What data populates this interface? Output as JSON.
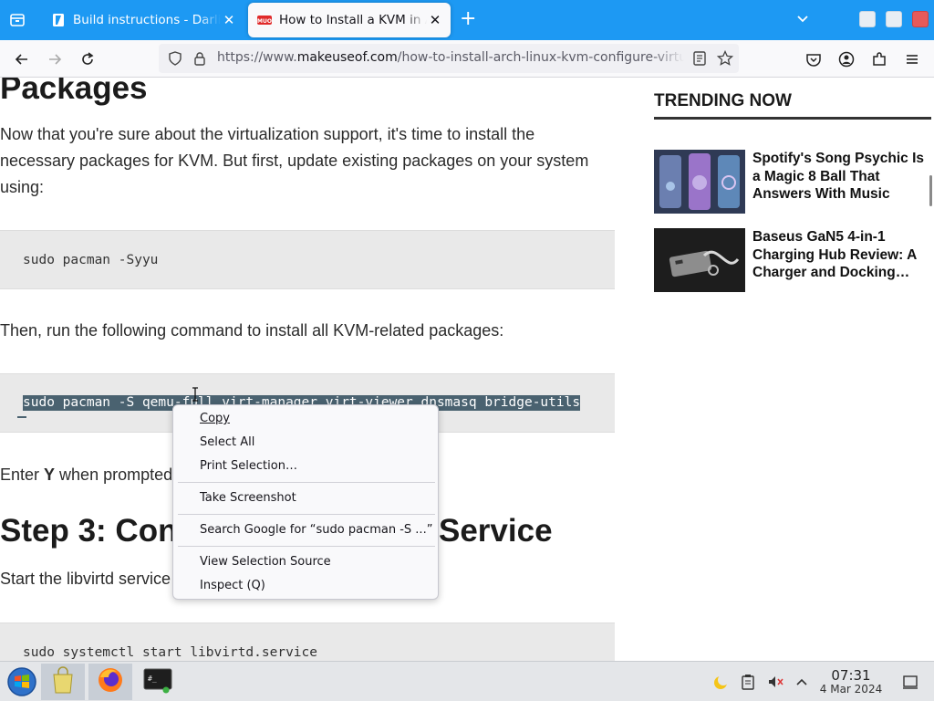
{
  "tabs": [
    {
      "title": "Build instructions - Darling",
      "close": "✕",
      "favicon": "book-icon"
    },
    {
      "title": "How to Install a KVM in Arch",
      "close": "✕",
      "favicon": "muo-icon"
    }
  ],
  "tabbar": {
    "new_tab": "+"
  },
  "url": {
    "prefix": "https://www.",
    "domain": "makeuseof.com",
    "path": "/how-to-install-arch-linux-kvm-configure-virtual-m"
  },
  "article": {
    "heading_packages": "Packages",
    "para1": "Now that you're sure about the virtualization support, it's time to install the necessary packages for KVM. But first, update existing packages on your system using:",
    "code1": "sudo pacman -Syyu",
    "para2": "Then, run the following command to install all KVM-related packages:",
    "code2": "sudo pacman -S qemu-full virt-manager virt-viewer dnsmasq bridge-utils",
    "para3_prefix": "Enter ",
    "para3_bold": "Y",
    "para3_suffix": " when prompted",
    "heading_step3_a": "Step 3: Con",
    "heading_step3_b": "Service",
    "para4": "Start the libvirtd service",
    "code3": "sudo systemctl start libvirtd.service"
  },
  "sidebar": {
    "title": "TRENDING NOW",
    "items": [
      {
        "title": "Spotify's Song Psychic Is a Magic 8 Ball That Answers With Music"
      },
      {
        "title": "Baseus GaN5 4-in-1 Charging Hub Review: A Charger and Docking…"
      }
    ]
  },
  "context_menu": {
    "items": [
      {
        "label": "Copy",
        "accel": "C"
      },
      {
        "label": "Select All",
        "accel": "A"
      },
      {
        "label": "Print Selection…",
        "accel": "r"
      },
      {
        "label": "Take Screenshot",
        "accel": "T"
      },
      {
        "label": "Search Google for “sudo pacman -S ...”",
        "accel": "S"
      },
      {
        "label": "View Selection Source",
        "accel": "e"
      },
      {
        "label": "Inspect (Q)",
        "accel": ""
      }
    ]
  },
  "taskbar": {
    "time": "07:31",
    "date": "4 Mar 2024"
  },
  "colors": {
    "tabbar": "#1d99f3",
    "selection": "#4a6270",
    "code_bg": "#e9e9e9"
  }
}
